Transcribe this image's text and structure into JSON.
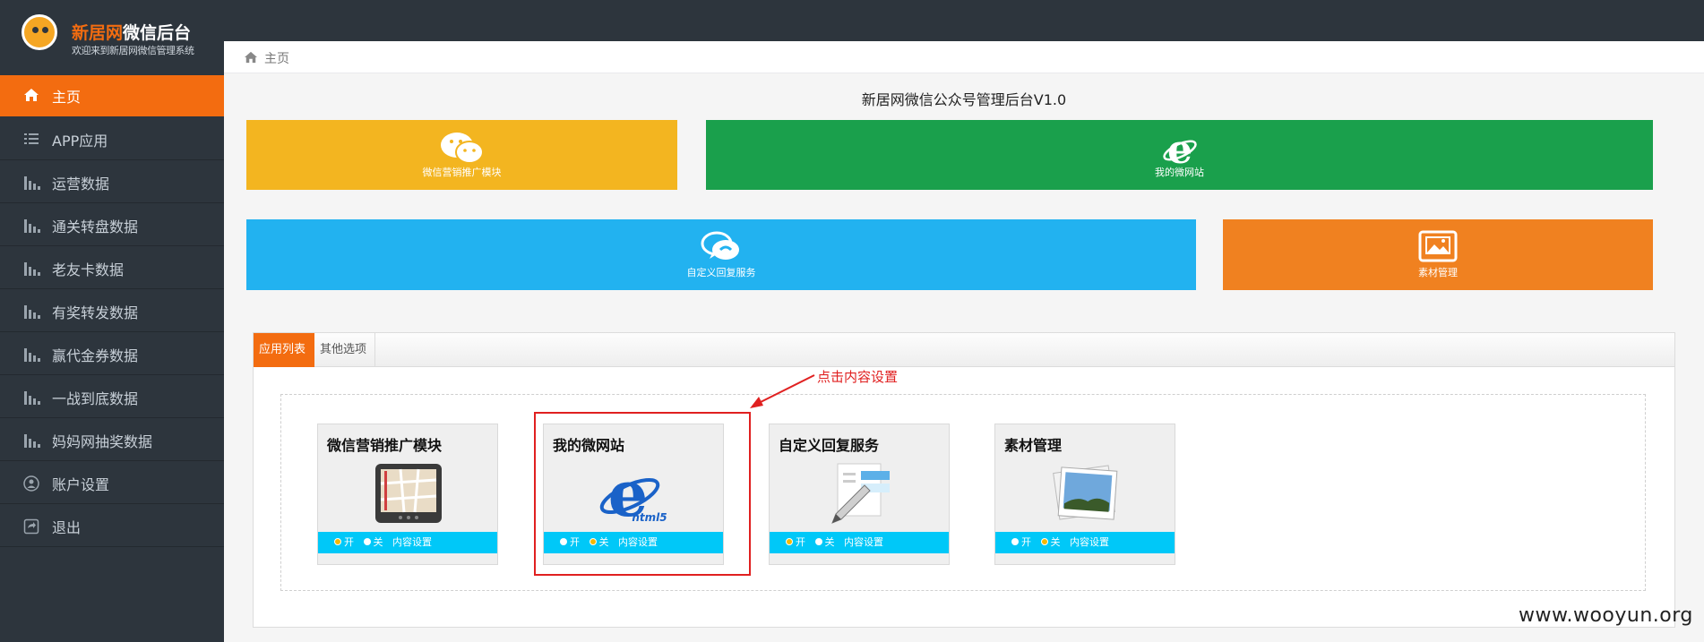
{
  "app": {
    "title_orange": "新居网",
    "title_white": "微信后台",
    "subtitle": "欢迎来到新居网微信管理系统"
  },
  "sidebar": {
    "items": [
      {
        "label": "主页",
        "icon": "home-icon"
      },
      {
        "label": "APP应用",
        "icon": "list-icon"
      },
      {
        "label": "运营数据",
        "icon": "bar-chart-icon"
      },
      {
        "label": "通关转盘数据",
        "icon": "bar-chart-icon"
      },
      {
        "label": "老友卡数据",
        "icon": "bar-chart-icon"
      },
      {
        "label": "有奖转发数据",
        "icon": "bar-chart-icon"
      },
      {
        "label": "赢代金券数据",
        "icon": "bar-chart-icon"
      },
      {
        "label": "一战到底数据",
        "icon": "bar-chart-icon"
      },
      {
        "label": "妈妈网抽奖数据",
        "icon": "bar-chart-icon"
      },
      {
        "label": "账户设置",
        "icon": "user-icon"
      },
      {
        "label": "退出",
        "icon": "logout-icon"
      }
    ]
  },
  "breadcrumb": {
    "label": "主页"
  },
  "main": {
    "title": "新居网微信公众号管理后台V1.0",
    "tiles": [
      {
        "label": "微信营销推广模块",
        "color": "#f3b520",
        "icon": "wechat-icon"
      },
      {
        "label": "我的微网站",
        "color": "#1aa04c",
        "icon": "ie-icon"
      },
      {
        "label": "自定义回复服务",
        "color": "#22b2f0",
        "icon": "chat-icon"
      },
      {
        "label": "素材管理",
        "color": "#f08120",
        "icon": "image-icon"
      }
    ],
    "tabs": [
      {
        "label": "应用列表",
        "active": true
      },
      {
        "label": "其他选项",
        "active": false
      }
    ],
    "cards": [
      {
        "title": "微信营销推广模块",
        "on_label": "开",
        "off_label": "关",
        "settings_label": "内容设置",
        "selected": "on",
        "icon": "map-tablet-icon"
      },
      {
        "title": "我的微网站",
        "on_label": "开",
        "off_label": "关",
        "settings_label": "内容设置",
        "selected": "off",
        "icon": "ie-html5-icon"
      },
      {
        "title": "自定义回复服务",
        "on_label": "开",
        "off_label": "关",
        "settings_label": "内容设置",
        "selected": "on",
        "icon": "document-pen-icon"
      },
      {
        "title": "素材管理",
        "on_label": "开",
        "off_label": "关",
        "settings_label": "内容设置",
        "selected": "off",
        "icon": "photos-icon"
      }
    ]
  },
  "annotation": {
    "text": "点击内容设置"
  },
  "watermark": "www.wooyun.org"
}
